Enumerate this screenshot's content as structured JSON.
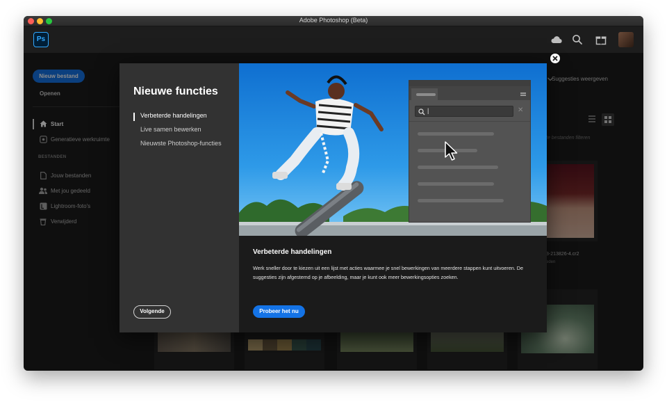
{
  "window": {
    "title": "Adobe Photoshop (Beta)"
  },
  "appbar": {
    "logo": "Ps",
    "icons": [
      "cloud-icon",
      "search-icon",
      "gift-icon"
    ]
  },
  "sidebar": {
    "new_file": "Nieuw bestand",
    "open": "Openen",
    "items": [
      {
        "label": "Start",
        "icon": "home-icon",
        "active": true
      },
      {
        "label": "Generatieve werkruimte",
        "icon": "generative-icon"
      }
    ],
    "section_label": "BESTANDEN",
    "file_items": [
      {
        "label": "Jouw bestanden",
        "icon": "file-icon"
      },
      {
        "label": "Met jou gedeeld",
        "icon": "shared-icon"
      },
      {
        "label": "Lightroom-foto's",
        "icon": "lightroom-icon"
      },
      {
        "label": "Verwijderd",
        "icon": "trash-icon"
      }
    ]
  },
  "background": {
    "suggestions": "Suggesties weergeven",
    "filter_placeholder": "te bestanden filteren",
    "file_name": "3-213826-4.cr2",
    "file_meta": "eden"
  },
  "modal": {
    "title": "Nieuwe functies",
    "features": [
      "Verbeterde handelingen",
      "Live samen bewerken",
      "Nieuwste Photoshop-functies"
    ],
    "active_feature": 0,
    "next_button": "Volgende",
    "body_heading": "Verbeterde handelingen",
    "body_text": "Werk sneller door te kiezen uit een lijst met acties waarmee je snel bewerkingen van meerdere stappen kunt uitvoeren. De suggesties zijn afgestemd op je afbeelding, maar je kunt ook meer bewerkingsopties zoeken.",
    "try_button": "Probeer het nu",
    "panel_search_value": "|"
  },
  "colors": {
    "accent_blue": "#1473e6",
    "window_bg": "#1d1d1d",
    "modal_left_bg": "#323232",
    "sky_blue": "#1d8fe0"
  }
}
